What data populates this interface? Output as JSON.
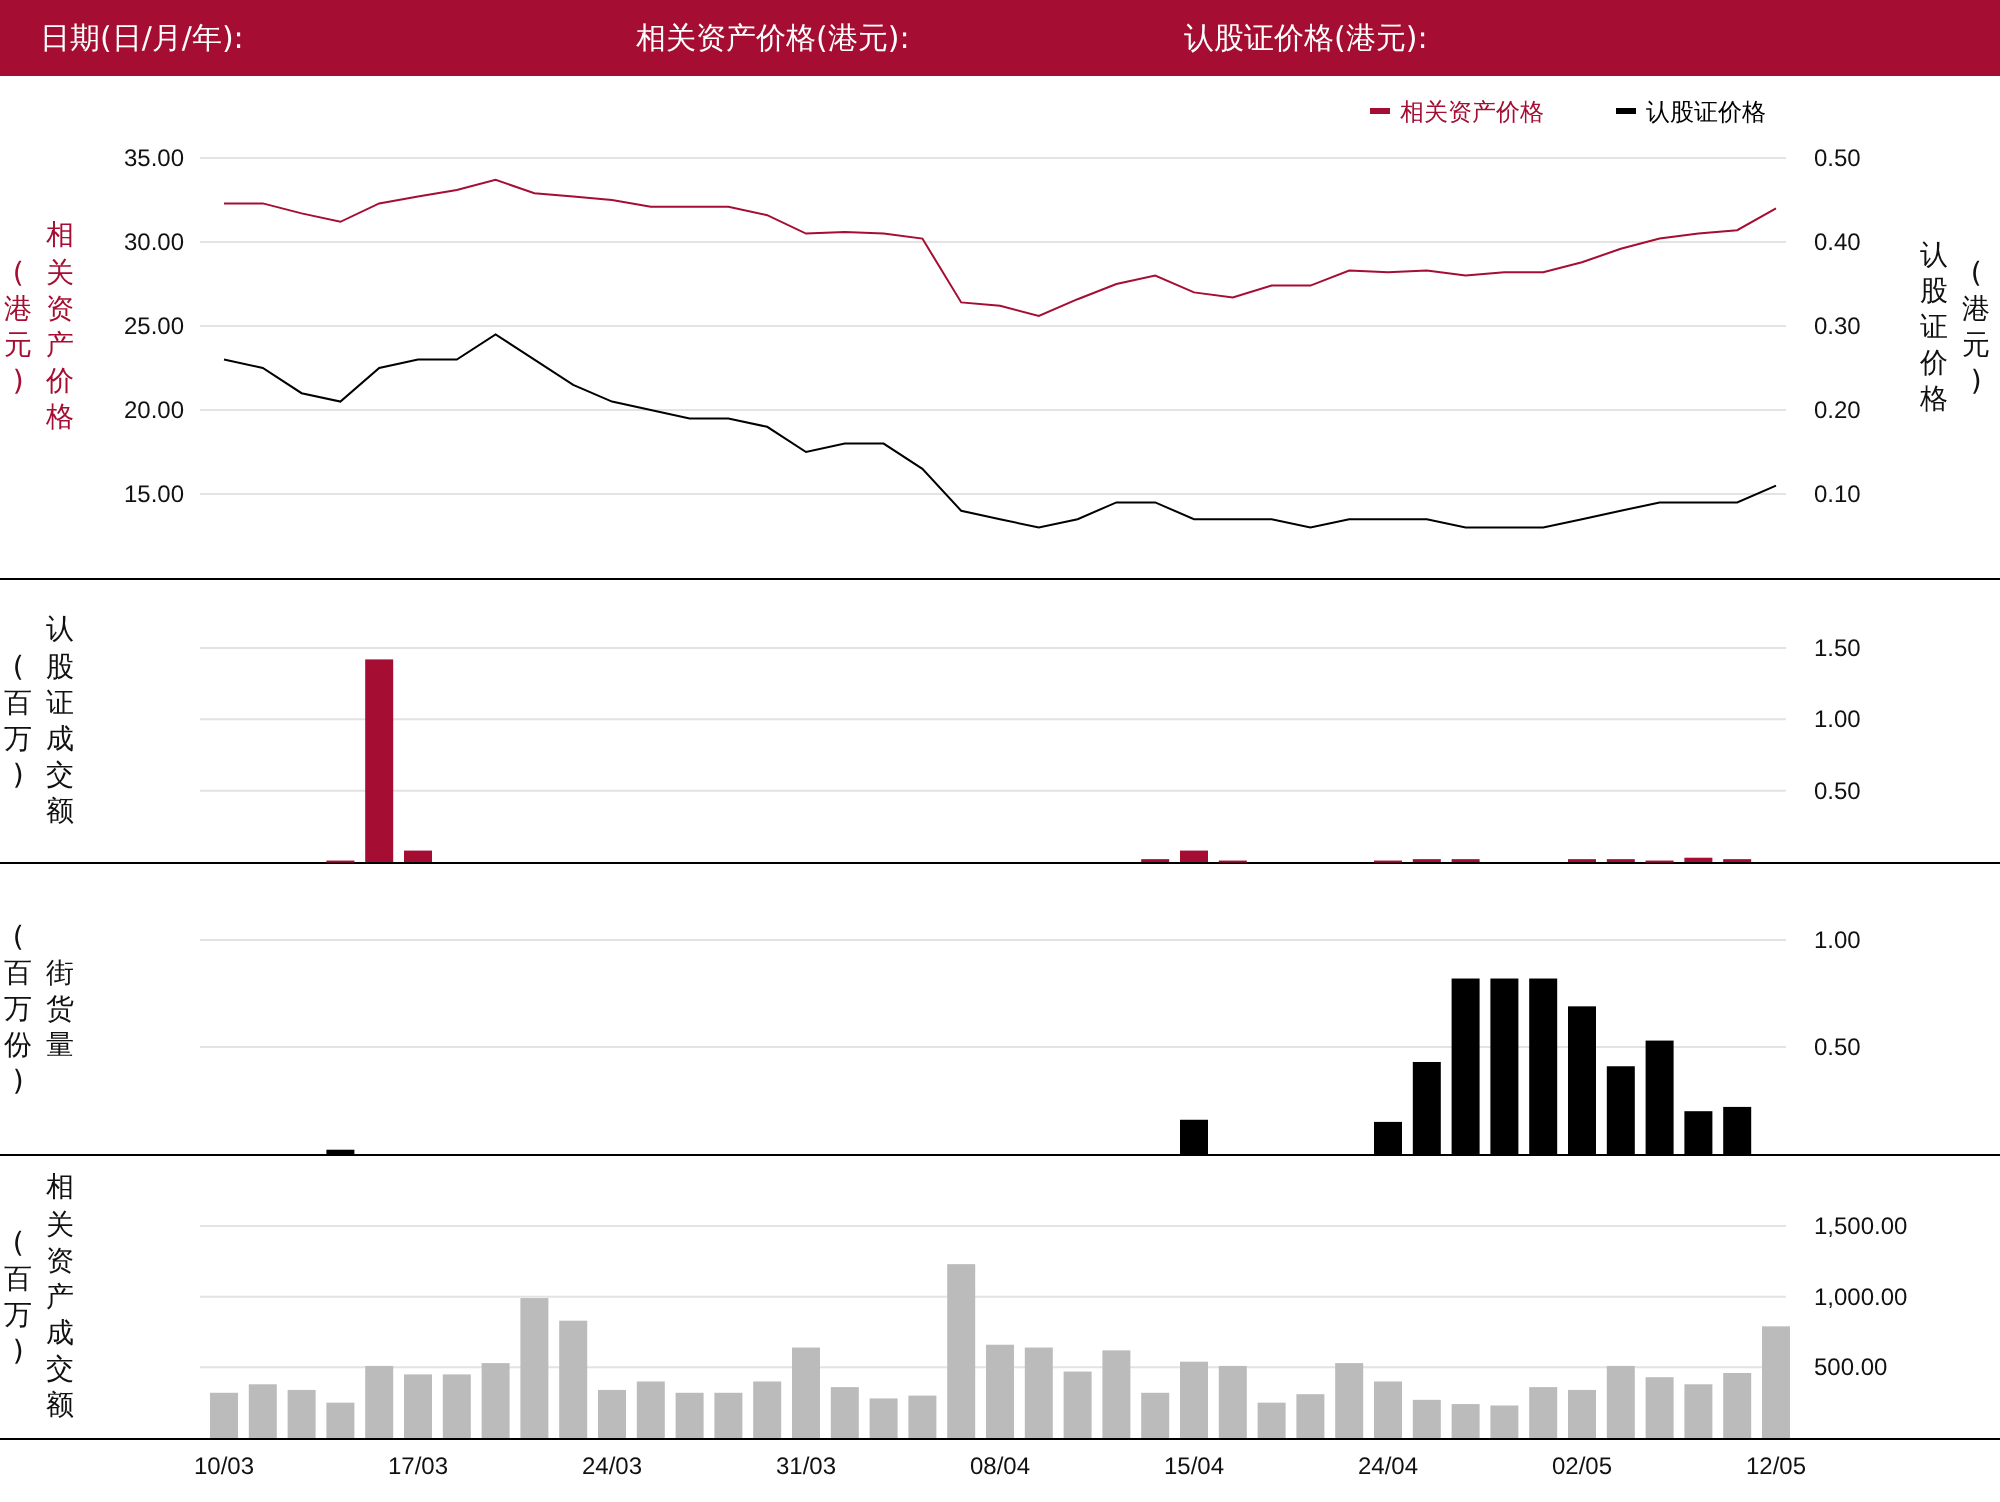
{
  "header": {
    "labels": [
      "日期(日/月/年):",
      "相关资产价格(港元):",
      "认股证价格(港元):"
    ]
  },
  "panels": [
    {
      "left_titles": [
        {
          "text": "(港元)",
          "color": "#a50d32"
        },
        {
          "text": "相关资产价格",
          "color": "#a50d32"
        }
      ],
      "right_titles": [
        {
          "text": "认股证价格",
          "color": "#111111"
        },
        {
          "text": "(港元)",
          "color": "#111111"
        }
      ],
      "chart_data": {
        "type": "line",
        "grid": true,
        "legend": "top-right",
        "ylim": [
          10,
          35
        ],
        "yticks": [
          {
            "value": 15,
            "label": "15.00"
          },
          {
            "value": 20,
            "label": "20.00"
          },
          {
            "value": 25,
            "label": "25.00"
          },
          {
            "value": 30,
            "label": "30.00"
          },
          {
            "value": 35,
            "label": "35.00"
          }
        ],
        "y2lim": [
          0,
          0.5
        ],
        "y2ticks": [
          {
            "value": 0.1,
            "label": "0.10"
          },
          {
            "value": 0.2,
            "label": "0.20"
          },
          {
            "value": 0.3,
            "label": "0.30"
          },
          {
            "value": 0.4,
            "label": "0.40"
          },
          {
            "value": 0.5,
            "label": "0.50"
          }
        ],
        "series": [
          {
            "name": "相关资产价格",
            "color": "#a50d32",
            "values": [
              32.3,
              32.3,
              31.7,
              31.2,
              32.3,
              32.7,
              33.1,
              33.7,
              32.9,
              32.7,
              32.5,
              32.1,
              32.1,
              32.1,
              31.6,
              30.5,
              30.6,
              30.5,
              30.2,
              26.4,
              26.2,
              25.6,
              26.6,
              27.5,
              28.0,
              27.0,
              26.7,
              27.4,
              27.4,
              28.3,
              28.2,
              28.3,
              28.0,
              28.2,
              28.2,
              28.8,
              29.6,
              30.2,
              30.5,
              30.7,
              32.0
            ]
          },
          {
            "name": "认股证价格",
            "color": "#000000",
            "axis": "y2",
            "values": [
              0.26,
              0.25,
              0.22,
              0.21,
              0.25,
              0.26,
              0.26,
              0.29,
              0.26,
              0.23,
              0.21,
              0.2,
              0.19,
              0.19,
              0.18,
              0.15,
              0.16,
              0.16,
              0.13,
              0.08,
              0.07,
              0.06,
              0.07,
              0.09,
              0.09,
              0.07,
              0.07,
              0.07,
              0.06,
              0.07,
              0.07,
              0.07,
              0.06,
              0.06,
              0.06,
              0.07,
              0.08,
              0.09,
              0.09,
              0.09,
              0.11
            ]
          }
        ]
      }
    },
    {
      "left_titles": [
        {
          "text": "(百万)",
          "color": "#111111"
        },
        {
          "text": "认股证成交额",
          "color": "#111111"
        }
      ],
      "chart_data": {
        "type": "bar",
        "grid": true,
        "ylim": [
          0,
          1.5
        ],
        "yticks": [
          {
            "value": 0.5,
            "label": "0.50"
          },
          {
            "value": 1,
            "label": "1.00"
          },
          {
            "value": 1.5,
            "label": "1.50"
          }
        ],
        "series": [
          {
            "color": "#a50d32",
            "values": [
              null,
              null,
              null,
              0.01,
              1.42,
              0.08,
              null,
              null,
              null,
              null,
              null,
              null,
              null,
              null,
              null,
              null,
              null,
              null,
              null,
              null,
              null,
              null,
              null,
              null,
              0.02,
              0.08,
              0.01,
              null,
              null,
              null,
              0.01,
              0.02,
              0.02,
              null,
              null,
              0.02,
              0.02,
              0.01,
              0.03,
              0.02,
              null
            ]
          }
        ]
      }
    },
    {
      "left_titles": [
        {
          "text": "(百万份)",
          "color": "#111111"
        },
        {
          "text": "街货量",
          "color": "#111111"
        }
      ],
      "chart_data": {
        "type": "bar",
        "grid": true,
        "ylim": [
          0,
          1
        ],
        "yticks": [
          {
            "value": 0.5,
            "label": "0.50"
          },
          {
            "value": 1,
            "label": "1.00"
          }
        ],
        "series": [
          {
            "color": "#000000",
            "values": [
              null,
              null,
              null,
              0.02,
              null,
              null,
              null,
              null,
              null,
              null,
              null,
              null,
              null,
              null,
              null,
              null,
              null,
              null,
              null,
              null,
              null,
              null,
              null,
              null,
              null,
              0.16,
              null,
              null,
              null,
              null,
              0.15,
              0.43,
              0.82,
              0.82,
              0.82,
              0.69,
              0.41,
              0.53,
              0.2,
              0.22,
              null
            ]
          }
        ]
      }
    },
    {
      "left_titles": [
        {
          "text": "(百万)",
          "color": "#111111"
        },
        {
          "text": "相关资产成交额",
          "color": "#111111"
        }
      ],
      "x_labels": [
        "10/03",
        "17/03",
        "24/03",
        "31/03",
        "08/04",
        "15/04",
        "24/04",
        "02/05",
        "12/05"
      ],
      "chart_data": {
        "type": "bar",
        "grid": true,
        "ylim": [
          0,
          1500
        ],
        "yticks": [
          {
            "value": 500,
            "label": "500.00"
          },
          {
            "value": 1000,
            "label": "1,000.00"
          },
          {
            "value": 1500,
            "label": "1,500.00"
          }
        ],
        "series": [
          {
            "color": "#bbbbbb",
            "values": [
              320,
              380,
              340,
              250,
              510,
              450,
              450,
              530,
              990,
              830,
              340,
              400,
              320,
              320,
              400,
              640,
              360,
              280,
              300,
              1230,
              660,
              640,
              470,
              620,
              320,
              540,
              510,
              250,
              310,
              530,
              400,
              270,
              240,
              230,
              360,
              340,
              510,
              430,
              380,
              460,
              790
            ]
          }
        ]
      }
    }
  ]
}
